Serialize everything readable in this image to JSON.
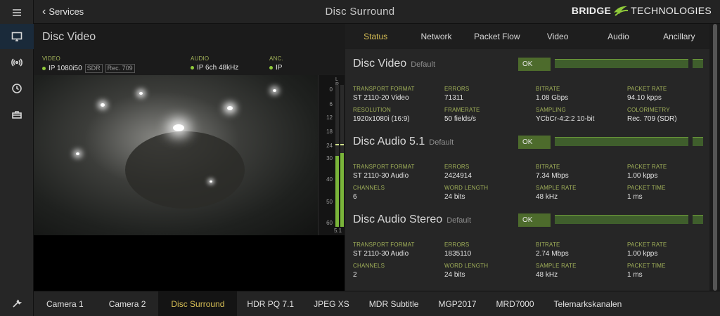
{
  "header": {
    "back_label": "Services",
    "title": "Disc Surround",
    "logo": {
      "word1": "BRIDGE",
      "word2": "TECHNOLOGIES",
      "accent_color": "#8fc93a"
    }
  },
  "rail": {
    "items": [
      {
        "icon": "menu-icon"
      },
      {
        "icon": "monitor-icon",
        "active": true
      },
      {
        "icon": "broadcast-icon"
      },
      {
        "icon": "clock-icon"
      },
      {
        "icon": "toolbox-icon"
      },
      {
        "icon": "wrench-icon"
      }
    ]
  },
  "video_panel": {
    "title": "Disc Video",
    "video": {
      "label": "VIDEO",
      "value": "IP 1080i50",
      "tags": [
        "SDR",
        "Rec. 709"
      ]
    },
    "audio": {
      "label": "AUDIO",
      "value": "IP 6ch 48kHz"
    },
    "anc": {
      "label": "ANC.",
      "value": "IP"
    },
    "meter": {
      "channels": "L R",
      "scale": [
        "0",
        "6",
        "12",
        "18",
        "24",
        "30",
        "40",
        "50",
        "60"
      ],
      "footer": "5.1",
      "levels": [
        0.5,
        0.52
      ]
    }
  },
  "main": {
    "status_tab_content": {
      "tabs": [
        "Status",
        "Network",
        "Packet Flow",
        "Video",
        "Audio",
        "Ancillary"
      ],
      "active_tab": "Status",
      "ok_label": "OK",
      "streams": [
        {
          "name": "Disc Video",
          "subtitle": "Default",
          "details": [
            {
              "label": "Transport Format",
              "value": "ST 2110-20 Video"
            },
            {
              "label": "Errors",
              "value": "71311"
            },
            {
              "label": "Bitrate",
              "value": "1.08 Gbps"
            },
            {
              "label": "Packet Rate",
              "value": "94.10 kpps"
            },
            {
              "label": "Resolution",
              "value": "1920x1080i (16:9)"
            },
            {
              "label": "Framerate",
              "value": "50 fields/s"
            },
            {
              "label": "Sampling",
              "value": "YCbCr-4:2:2 10-bit"
            },
            {
              "label": "Colorimetry",
              "value": "Rec. 709 (SDR)"
            }
          ]
        },
        {
          "name": "Disc Audio 5.1",
          "subtitle": "Default",
          "details": [
            {
              "label": "Transport Format",
              "value": "ST 2110-30 Audio"
            },
            {
              "label": "Errors",
              "value": "2424914"
            },
            {
              "label": "Bitrate",
              "value": "7.34 Mbps"
            },
            {
              "label": "Packet Rate",
              "value": "1.00 kpps"
            },
            {
              "label": "Channels",
              "value": "6"
            },
            {
              "label": "Word Length",
              "value": "24 bits"
            },
            {
              "label": "Sample Rate",
              "value": "48 kHz"
            },
            {
              "label": "Packet Time",
              "value": "1 ms"
            }
          ]
        },
        {
          "name": "Disc Audio Stereo",
          "subtitle": "Default",
          "details": [
            {
              "label": "Transport Format",
              "value": "ST 2110-30 Audio"
            },
            {
              "label": "Errors",
              "value": "1835110"
            },
            {
              "label": "Bitrate",
              "value": "2.74 Mbps"
            },
            {
              "label": "Packet Rate",
              "value": "1.00 kpps"
            },
            {
              "label": "Channels",
              "value": "2"
            },
            {
              "label": "Word Length",
              "value": "24 bits"
            },
            {
              "label": "Sample Rate",
              "value": "48 kHz"
            },
            {
              "label": "Packet Time",
              "value": "1 ms"
            }
          ]
        }
      ]
    }
  },
  "bottom_tabs": {
    "items": [
      "Camera 1",
      "Camera 2",
      "Disc Surround",
      "HDR PQ 7.1",
      "JPEG XS",
      "MDR Subtitle",
      "MGP2017",
      "MRD7000",
      "Telemarkskanalen"
    ],
    "active": "Disc Surround"
  },
  "colors": {
    "accent": "#d7bf55",
    "ok": "#4d6b2c",
    "label_green": "#a3b35a"
  }
}
